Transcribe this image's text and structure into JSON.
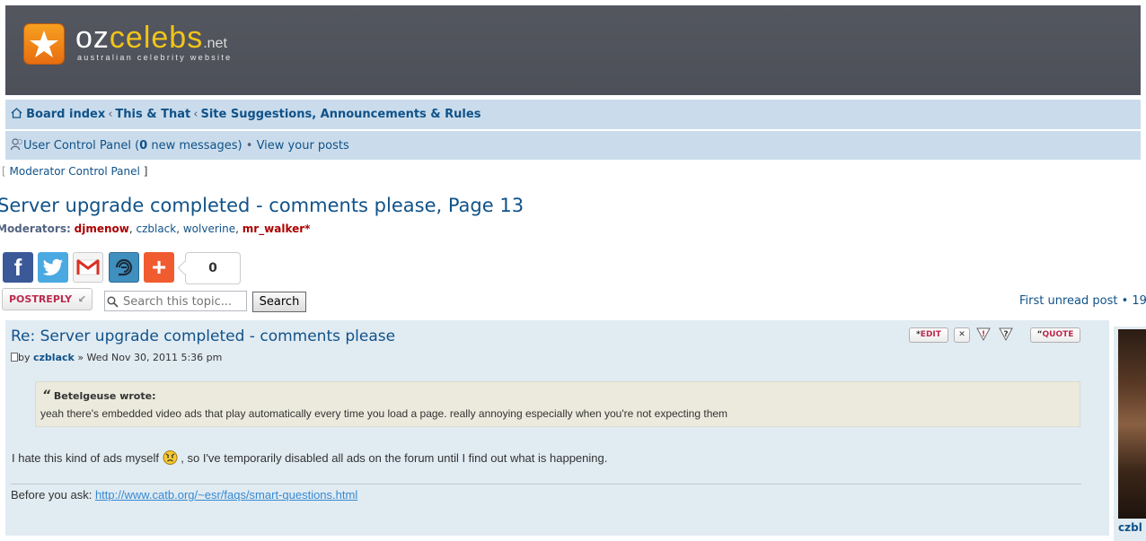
{
  "header": {
    "logo_oz": "oz",
    "logo_celebs": "celebs",
    "logo_net": ".net",
    "tagline": "australian celebrity website"
  },
  "breadcrumb": {
    "items": [
      "Board index",
      "This & That",
      "Site Suggestions, Announcements & Rules"
    ],
    "separator": "‹"
  },
  "user_bar": {
    "ucp_label": "User Control Panel (",
    "new_count": "0",
    "ucp_suffix": " new messages)",
    "bullet": "•",
    "view_posts": "View your posts"
  },
  "mcp": {
    "open": "[",
    "label": "Moderator Control Panel",
    "close": "]"
  },
  "topic": {
    "title": "Server upgrade completed - comments please, Page 13",
    "moderators_label": "Moderators:",
    "moderators": [
      {
        "name": "djmenow",
        "sep": ", "
      },
      {
        "name": "czblack",
        "sep": ", "
      },
      {
        "name": "wolverine",
        "sep": ", "
      },
      {
        "name": "mr_walker*",
        "sep": ""
      }
    ]
  },
  "share": {
    "count": "0",
    "buttons": [
      "facebook",
      "twitter",
      "gmail",
      "email",
      "addthis"
    ]
  },
  "actions": {
    "post_reply": "POSTREPLY",
    "search_placeholder": "Search this topic...",
    "search_button": "Search",
    "first_unread": "First unread post",
    "pagination_tail": "• 19"
  },
  "post": {
    "title": "Re: Server upgrade completed - comments please",
    "by": "by",
    "author": "czblack",
    "date": "» Wed Nov 30, 2011 5:36 pm",
    "buttons": {
      "edit": "EDIT",
      "quote": "QUOTE"
    },
    "quote_cite": "Betelgeuse wrote:",
    "quote_text": "yeah there's embedded video ads that play automatically every time you load a page. really annoying especially when you're not expecting them",
    "body_before": "I hate this kind of ads myself",
    "body_after": " , so I've temporarily disabled all ads on the forum until I find out what is happening.",
    "sig_label": "Before you ask: ",
    "sig_url": "http://www.catb.org/~esr/faqs/smart-questions.html"
  },
  "profile": {
    "name": "czbl"
  },
  "colors": {
    "link": "#105289",
    "nav_bg": "#cadceb",
    "post_bg": "#e1ebf2",
    "header_bg": "#54575f",
    "moderator_red": "#aa0000"
  }
}
